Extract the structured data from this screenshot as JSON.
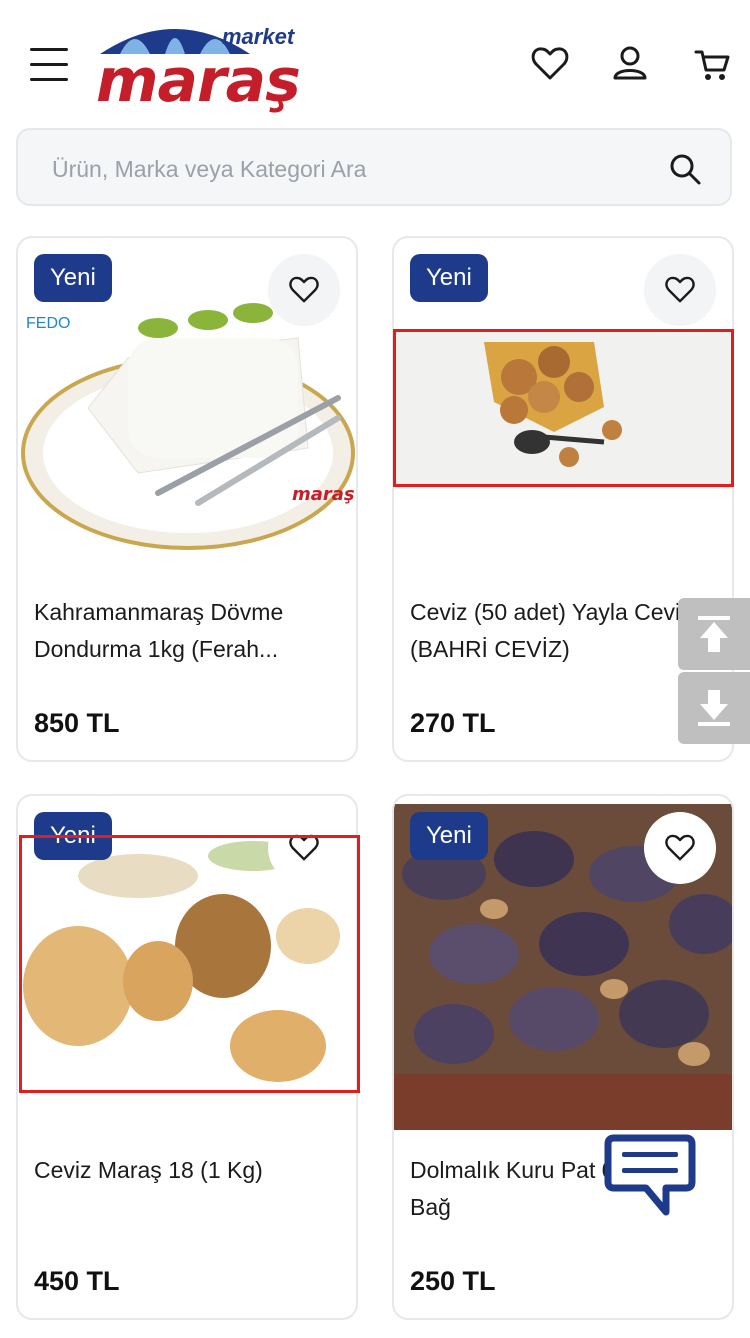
{
  "brand": {
    "name": "maraş",
    "sub": "market"
  },
  "search": {
    "placeholder": "Ürün, Marka veya Kategori Ara"
  },
  "badge_label": "Yeni",
  "products": [
    {
      "title": "Kahramanmaraş Dövme Dondurma 1kg (Ferah...",
      "price": "850 TL",
      "logo_text_top": "FEDO",
      "logo_text_bottom": "maraş"
    },
    {
      "title": "Ceviz (50 adet) Yayla Cevizi (BAHRİ CEVİZ)",
      "price": "270 TL"
    },
    {
      "title": "Ceviz Maraş 18 (1 Kg)",
      "price": "450 TL"
    },
    {
      "title": "Dolmalık Kuru Pat 0 adet) 1 Bağ",
      "price": "250 TL"
    }
  ],
  "colors": {
    "brand_red": "#c41e2a",
    "brand_blue": "#1e3a8a",
    "badge_bg": "#1e3a8a"
  },
  "icons": [
    "menu-icon",
    "heart-icon",
    "user-icon",
    "cart-icon",
    "search-icon",
    "arrow-up-icon",
    "arrow-down-icon",
    "chat-icon"
  ]
}
